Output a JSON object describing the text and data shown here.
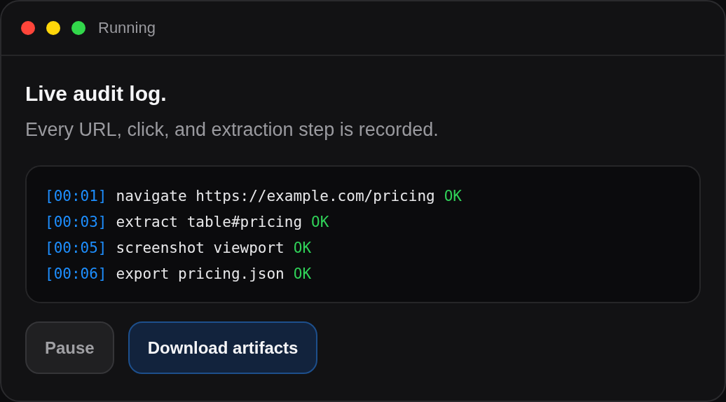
{
  "window": {
    "title": "Running"
  },
  "heading": "Live audit log.",
  "subtitle": "Every URL, click, and extraction step is recorded.",
  "log": [
    {
      "time": "[00:01]",
      "action": "navigate https://example.com/pricing",
      "result": "OK",
      "kind": "ok"
    },
    {
      "time": "[00:03]",
      "action": "extract table#pricing",
      "result": "OK",
      "kind": "ok"
    },
    {
      "time": "[00:05]",
      "action": "screenshot viewport",
      "result": "OK",
      "kind": "ok"
    },
    {
      "time": "[00:06]",
      "action": "export pricing.json",
      "result": "OK",
      "kind": "ok"
    }
  ],
  "buttons": [
    {
      "label": "Pause",
      "kind": "secondary"
    },
    {
      "label": "Download artifacts",
      "kind": "primary"
    }
  ]
}
